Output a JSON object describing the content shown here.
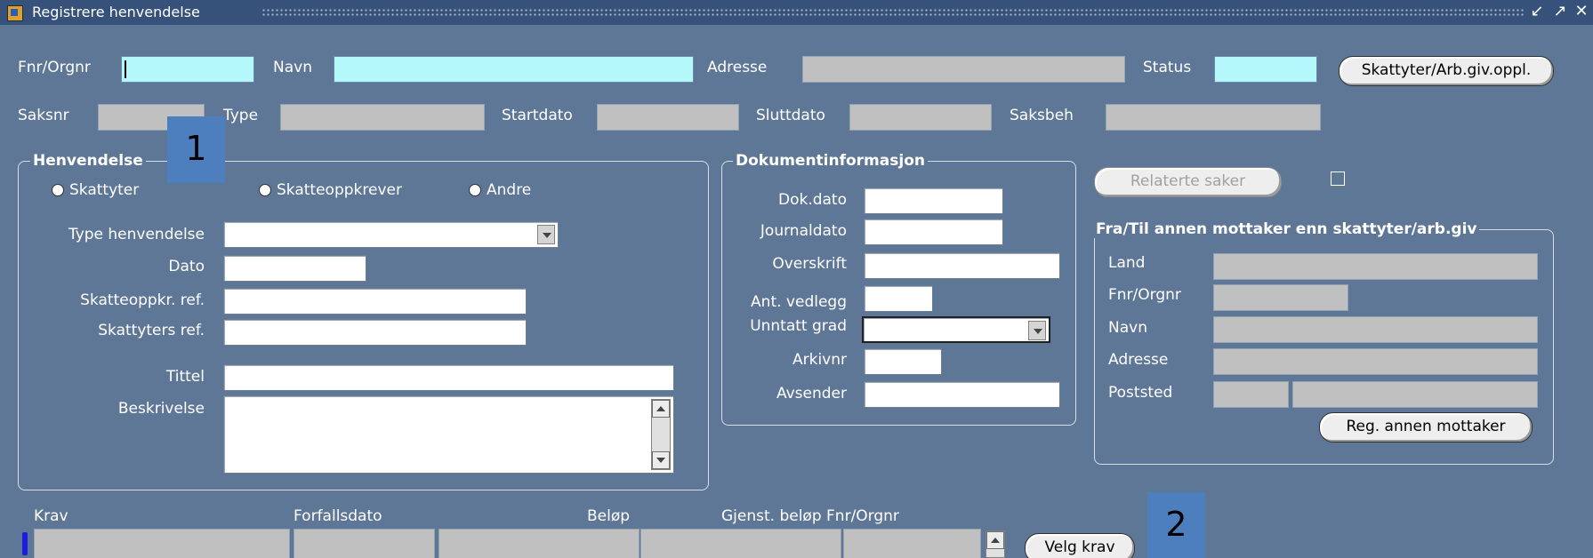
{
  "window": {
    "title": "Registrere henvendelse",
    "minimize_icon": "minimize-icon",
    "maximize_icon": "maximize-icon",
    "close_icon": "close-icon"
  },
  "header": {
    "fnr_label": "Fnr/Orgnr",
    "navn_label": "Navn",
    "adresse_label": "Adresse",
    "status_label": "Status",
    "skattyter_btn": "Skattyter/Arb.giv.oppl.",
    "saksnr_label": "Saksnr",
    "type_label": "Type",
    "startdato_label": "Startdato",
    "sluttdato_label": "Sluttdato",
    "saksbeh_label": "Saksbeh"
  },
  "henvendelse": {
    "legend": "Henvendelse",
    "radios": [
      "Skattyter",
      "Skatteoppkrever",
      "Andre"
    ],
    "type_label": "Type henvendelse",
    "dato_label": "Dato",
    "skatteoppkr_ref_label": "Skatteoppkr. ref.",
    "skattyters_ref_label": "Skattyters ref.",
    "tittel_label": "Tittel",
    "beskrivelse_label": "Beskrivelse"
  },
  "dokument": {
    "legend": "Dokumentinformasjon",
    "dokdato_label": "Dok.dato",
    "journaldato_label": "Journaldato",
    "overskrift_label": "Overskrift",
    "vedlegg_label": "Ant. vedlegg",
    "unntatt_label": "Unntatt grad",
    "arkivnr_label": "Arkivnr",
    "avsender_label": "Avsender"
  },
  "relaterte_btn": "Relaterte saker",
  "annen": {
    "legend": "Fra/Til annen mottaker enn skattyter/arb.giv",
    "land_label": "Land",
    "fnr_label": "Fnr/Orgnr",
    "navn_label": "Navn",
    "adresse_label": "Adresse",
    "poststed_label": "Poststed",
    "reg_btn": "Reg. annen mottaker"
  },
  "krav": {
    "krav_label": "Krav",
    "forfallsdato_label": "Forfallsdato",
    "belop_label": "Beløp",
    "gjenst_label": "Gjenst. beløp Fnr/Orgnr",
    "velg_btn": "Velg krav"
  },
  "badges": {
    "b1": "1",
    "b2": "2"
  },
  "colors": {
    "background": "#5f7797",
    "titlebar": "#36527a",
    "required_field": "#b5f8fc",
    "readonly_field": "#c0c0c0",
    "badge": "#4d7fbf"
  }
}
